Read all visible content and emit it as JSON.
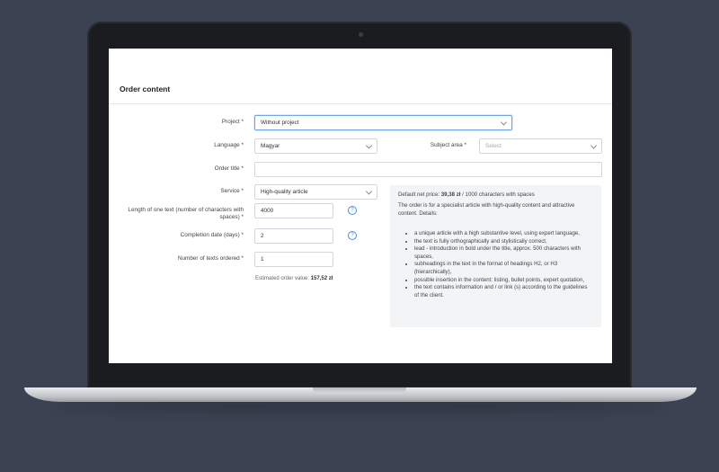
{
  "page": {
    "title": "Order content"
  },
  "form": {
    "project": {
      "label": "Project *",
      "value": "Without project"
    },
    "language": {
      "label": "Language *",
      "value": "Magyar"
    },
    "subject": {
      "label": "Subject area *",
      "placeholder": "Select"
    },
    "order_title": {
      "label": "Order title *",
      "value": ""
    },
    "service": {
      "label": "Service *",
      "value": "High-quality article"
    },
    "length": {
      "label": "Length of one text (number of characters with spaces) *",
      "value": "4000"
    },
    "completion": {
      "label": "Completion date (days) *",
      "value": "2"
    },
    "count": {
      "label": "Number of texts ordered *",
      "value": "1"
    },
    "estimate_label": "Estimated order value:",
    "estimate_value": "157,52 zł",
    "help_glyph": "?"
  },
  "info": {
    "price_prefix": "Default net price:",
    "price_value": "39,38 zł",
    "price_suffix": "/ 1000 characters with spaces",
    "description": "The order is for a specialist article with high-quality content and attractive content. Details:",
    "bullets": [
      "a unique article with a high substantive level, using expert language,",
      "the text is fully orthographically and stylistically correct,",
      "lead - introduction in bold under the title, approx. 500 characters with spaces,",
      "subheadings in the text in the format of headings H2, or H3 (hierarchically),",
      "possible insertion in the content: listing, bullet points, expert quotation,",
      "the text contains information and / or link (s) according to the guidelines of the client."
    ]
  },
  "colors": {
    "accent": "#4a8ee0",
    "background": "#3b4252"
  }
}
